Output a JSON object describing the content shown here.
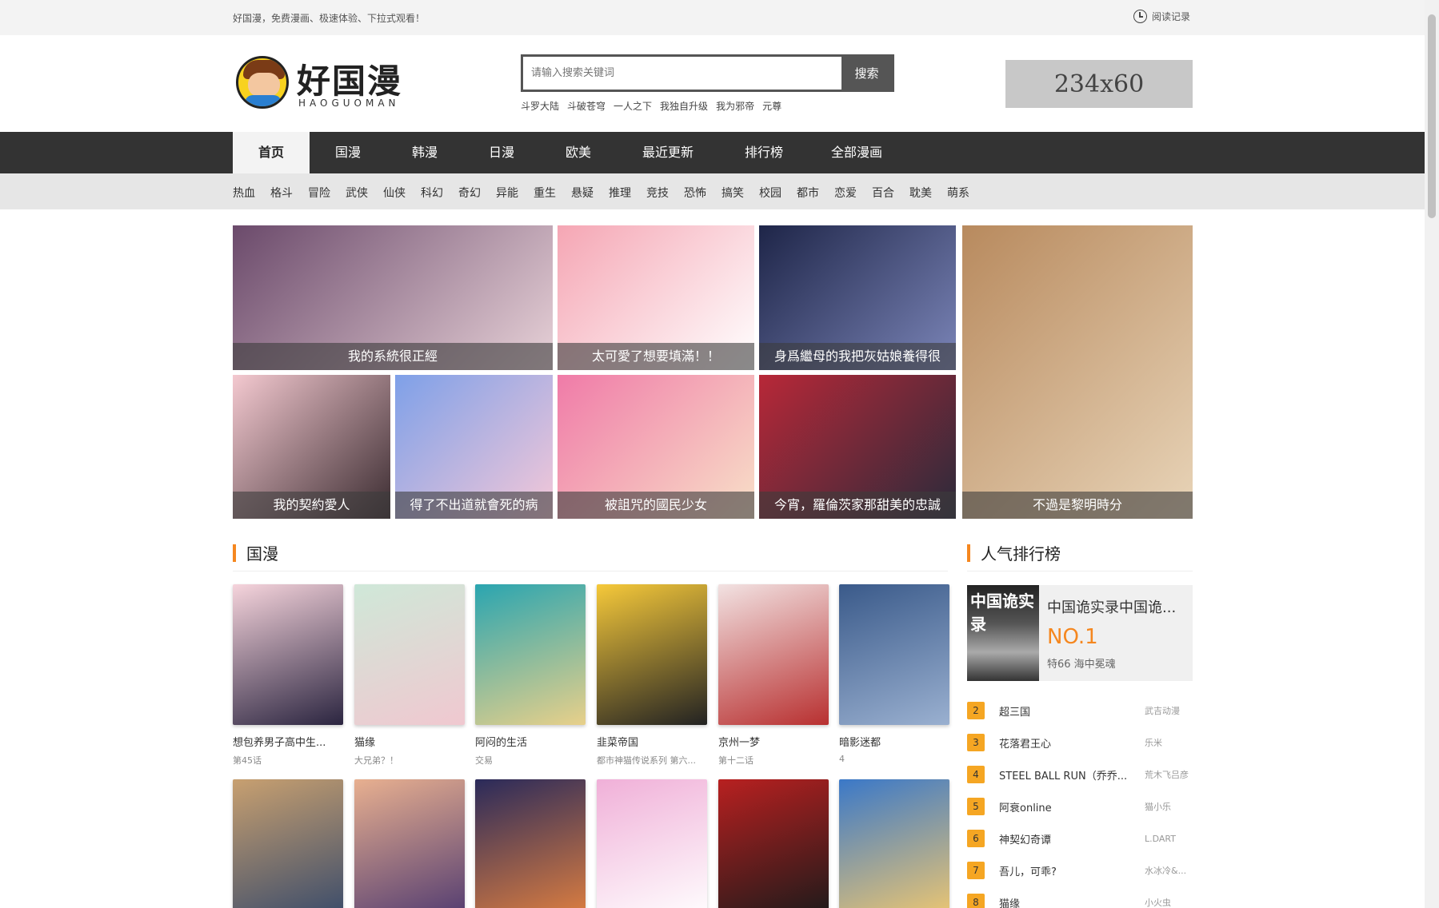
{
  "topbar": {
    "slogan": "好国漫，免费漫画、极速体验、下拉式观看！",
    "history_label": "阅读记录"
  },
  "logo": {
    "brand": "好国漫",
    "pinyin": "HAOGUOMAN"
  },
  "search": {
    "placeholder": "请输入搜索关键词",
    "button_label": "搜索",
    "hot_words": [
      "斗罗大陆",
      "斗破苍穹",
      "一人之下",
      "我独自升级",
      "我为邪帝",
      "元尊"
    ]
  },
  "ad": {
    "label": "234x60"
  },
  "nav": {
    "items": [
      "首页",
      "国漫",
      "韩漫",
      "日漫",
      "欧美",
      "最近更新",
      "排行榜",
      "全部漫画"
    ],
    "active": "首页"
  },
  "subnav": {
    "items": [
      "热血",
      "格斗",
      "冒险",
      "武侠",
      "仙侠",
      "科幻",
      "奇幻",
      "异能",
      "重生",
      "悬疑",
      "推理",
      "竞技",
      "恐怖",
      "搞笑",
      "校园",
      "都市",
      "恋爱",
      "百合",
      "耽美",
      "萌系"
    ]
  },
  "banner": [
    {
      "title": "我的系統很正經",
      "colors": [
        "#6b4a6b",
        "#e8d2d8"
      ]
    },
    {
      "title": "太可愛了想要填滿！！",
      "colors": [
        "#f5a6b4",
        "#ffffff"
      ]
    },
    {
      "title": "身爲繼母的我把灰姑娘養得很",
      "colors": [
        "#1e2548",
        "#7b85b8"
      ]
    },
    {
      "title": "不過是黎明時分",
      "colors": [
        "#b88a5e",
        "#e8d4b8"
      ]
    },
    {
      "title": "我的契約愛人",
      "colors": [
        "#f4c9d0",
        "#3a2b30"
      ]
    },
    {
      "title": "得了不出道就會死的病",
      "colors": [
        "#7ea0e8",
        "#f5c8d8"
      ]
    },
    {
      "title": "被詛咒的國民少女",
      "colors": [
        "#f07ba8",
        "#f8e0c8"
      ]
    },
    {
      "title": "今宵，羅倫茨家那甜美的忠誠",
      "colors": [
        "#b82838",
        "#2a2a3a"
      ]
    }
  ],
  "guoman": {
    "title": "国漫",
    "row1": [
      {
        "name": "想包养男子高中生...",
        "ep": "第45话",
        "colors": [
          "#f6d4dc",
          "#2b2540"
        ]
      },
      {
        "name": "猫缘",
        "ep": "大兄弟？！",
        "colors": [
          "#cfe8d8",
          "#f0c8d0"
        ]
      },
      {
        "name": "阿闷的生活",
        "ep": "交易",
        "colors": [
          "#2aa5b0",
          "#e8d08a"
        ]
      },
      {
        "name": "韭菜帝国",
        "ep": "都市神猫传说系列 第六...",
        "colors": [
          "#f6c93a",
          "#222222"
        ]
      },
      {
        "name": "京州一梦",
        "ep": "第十二话",
        "colors": [
          "#f2e2e2",
          "#b83030"
        ]
      },
      {
        "name": "暗影迷都",
        "ep": "4",
        "colors": [
          "#3a5a8a",
          "#9ab0d0"
        ]
      }
    ],
    "row2": [
      {
        "colors": [
          "#c8a070",
          "#384a6a"
        ]
      },
      {
        "colors": [
          "#e8b090",
          "#503a70"
        ]
      },
      {
        "colors": [
          "#2a2a5a",
          "#e08040"
        ]
      },
      {
        "colors": [
          "#f0b0d8",
          "#ffffff"
        ]
      },
      {
        "colors": [
          "#b82020",
          "#1a1a1a"
        ]
      },
      {
        "colors": [
          "#3a78c8",
          "#f0c870"
        ]
      }
    ]
  },
  "ranking": {
    "title": "人气排行榜",
    "top": {
      "cover_text": "中国诡实录",
      "title": "中国诡实录中国诡...",
      "no": "NO.1",
      "desc": "特66 海中冕魂"
    },
    "items": [
      {
        "num": "2",
        "title": "超三国",
        "author": "武吉动漫"
      },
      {
        "num": "3",
        "title": "花落君王心",
        "author": "乐米"
      },
      {
        "num": "4",
        "title": "STEEL BALL RUN（乔乔...",
        "author": "荒木飞吕彦"
      },
      {
        "num": "5",
        "title": "阿衰online",
        "author": "猫小乐"
      },
      {
        "num": "6",
        "title": "神契幻奇谭",
        "author": "L.DART"
      },
      {
        "num": "7",
        "title": "吾儿，可乖?",
        "author": "水冰冷&..."
      },
      {
        "num": "8",
        "title": "猫缘",
        "author": "小火虫"
      }
    ]
  }
}
